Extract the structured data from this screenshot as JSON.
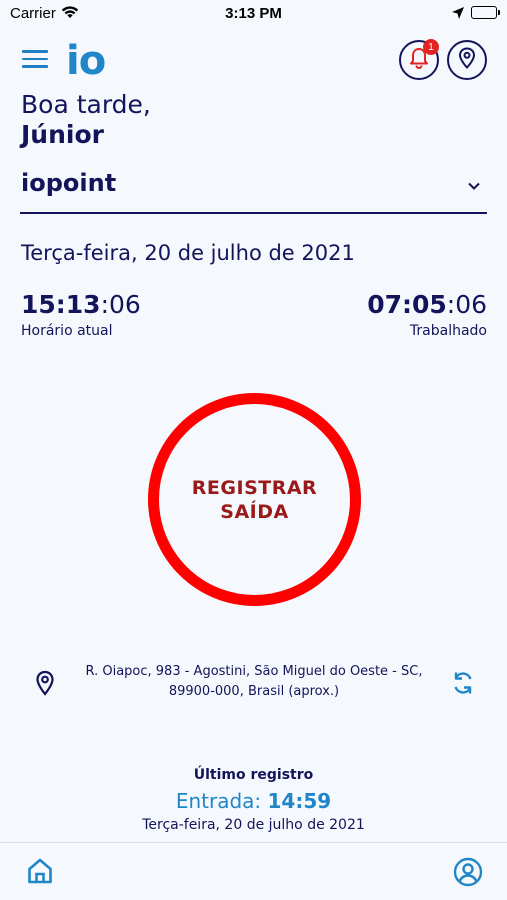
{
  "status_bar": {
    "carrier": "Carrier",
    "time": "3:13 PM"
  },
  "header": {
    "logo": "io",
    "notification_count": "1"
  },
  "greeting": {
    "line1": "Boa tarde,",
    "name": "Júnior"
  },
  "company": {
    "selected": "iopoint"
  },
  "date": "Terça-feira, 20 de julho  de 2021",
  "clocks": {
    "current": {
      "hm": "15:13",
      "sec": ":06",
      "label": "Horário atual"
    },
    "worked": {
      "hm": "07:05",
      "sec": ":06",
      "label": "Trabalhado"
    }
  },
  "register_button": {
    "line1": "REGISTRAR",
    "line2": "SAÍDA"
  },
  "location": {
    "line1": "R. Oiapoc, 983 - Agostini, São Miguel do Oeste - SC,",
    "line2": "89900-000, Brasil (aprox.)"
  },
  "last_record": {
    "title": "Último registro",
    "type": "Entrada: ",
    "time": "14:59",
    "date": "Terça-feira, 20 de julho  de 2021"
  },
  "colors": {
    "navy": "#14145a",
    "brand_blue": "#1f86c8",
    "register_red": "#ff0000",
    "badge_red": "#e32222"
  },
  "icons": [
    "wifi-icon",
    "location-arrow-icon",
    "battery-icon",
    "menu-icon",
    "bell-icon",
    "map-pin-icon",
    "chevron-down-icon",
    "refresh-icon",
    "home-icon",
    "profile-icon"
  ]
}
